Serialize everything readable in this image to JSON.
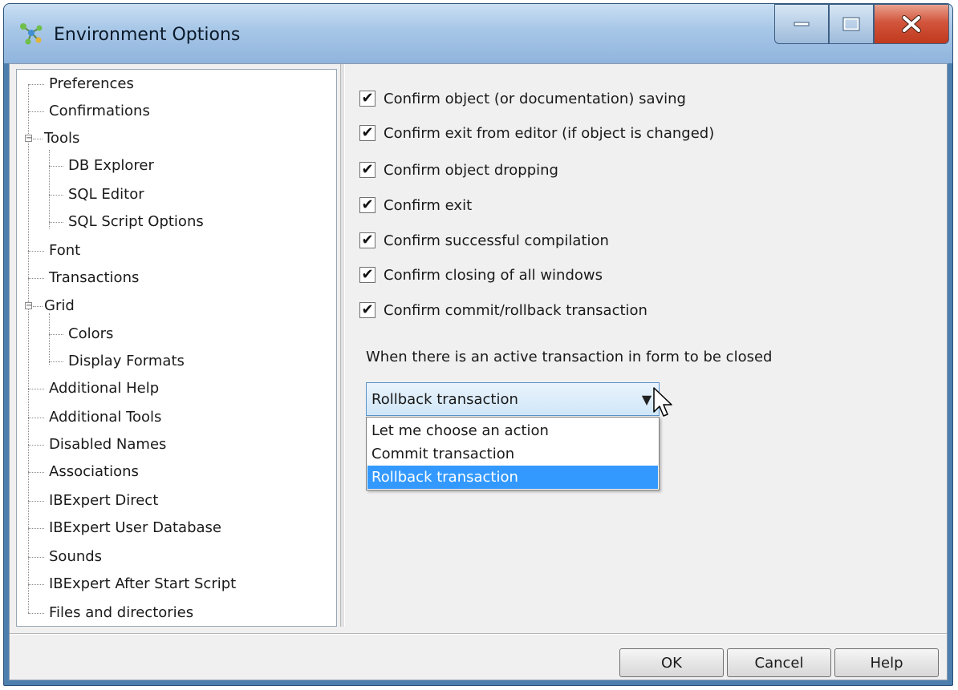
{
  "window": {
    "title": "Environment Options",
    "icons": {
      "app": "tree-nodes-icon",
      "minimize": "minimize-icon",
      "maximize": "maximize-icon",
      "close": "close-icon"
    }
  },
  "tree": {
    "items": [
      {
        "label": "Preferences",
        "level": 0
      },
      {
        "label": "Confirmations",
        "level": 0
      },
      {
        "label": "Tools",
        "level": 0,
        "expandable": true,
        "expanded": true
      },
      {
        "label": "DB Explorer",
        "level": 1
      },
      {
        "label": "SQL Editor",
        "level": 1
      },
      {
        "label": "SQL Script Options",
        "level": 1
      },
      {
        "label": "Font",
        "level": 0
      },
      {
        "label": "Transactions",
        "level": 0
      },
      {
        "label": "Grid",
        "level": 0,
        "expandable": true,
        "expanded": true
      },
      {
        "label": "Colors",
        "level": 1
      },
      {
        "label": "Display Formats",
        "level": 1
      },
      {
        "label": "Additional Help",
        "level": 0
      },
      {
        "label": "Additional Tools",
        "level": 0
      },
      {
        "label": "Disabled Names",
        "level": 0
      },
      {
        "label": "Associations",
        "level": 0
      },
      {
        "label": "IBExpert Direct",
        "level": 0
      },
      {
        "label": "IBExpert User Database",
        "level": 0
      },
      {
        "label": "Sounds",
        "level": 0
      },
      {
        "label": "IBExpert After Start Script",
        "level": 0
      },
      {
        "label": "Files and directories",
        "level": 0
      }
    ]
  },
  "options": {
    "checkboxes": [
      {
        "label": "Confirm object (or documentation) saving",
        "checked": true
      },
      {
        "label": "Confirm exit from editor (if object is changed)",
        "checked": true
      },
      {
        "label": "Confirm object dropping",
        "checked": true
      },
      {
        "label": "Confirm exit",
        "checked": true
      },
      {
        "label": "Confirm successful compilation",
        "checked": true
      },
      {
        "label": "Confirm closing of all windows",
        "checked": true
      },
      {
        "label": "Confirm commit/rollback transaction",
        "checked": true
      }
    ],
    "check_glyph": "✔",
    "transaction_prompt": "When there is an active transaction in form to be closed",
    "combo": {
      "value": "Rollback transaction",
      "arrow": "▼",
      "options": [
        "Let me choose an action",
        "Commit transaction",
        "Rollback transaction"
      ],
      "selected": "Rollback transaction"
    }
  },
  "buttons": {
    "ok": "OK",
    "cancel": "Cancel",
    "help": "Help"
  },
  "colors": {
    "selection": "#3399ff",
    "title_bar": "#a9c8e8",
    "close_button": "#c0391d"
  }
}
